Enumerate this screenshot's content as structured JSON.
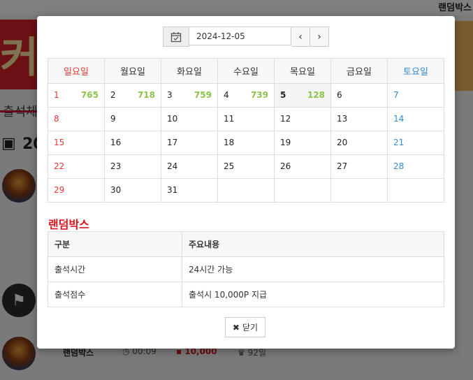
{
  "background": {
    "top_right_text": "랜덤박스",
    "section_label": "출석체",
    "year_partial": "20",
    "row": {
      "name": "랜덤박스",
      "time": "00:09",
      "points": "10,000",
      "days": "92일"
    }
  },
  "modal": {
    "date_value": "2024-12-05",
    "prev_label": "‹",
    "next_label": "›",
    "weekdays": [
      "일요일",
      "월요일",
      "화요일",
      "수요일",
      "목요일",
      "금요일",
      "토요일"
    ],
    "weeks": [
      [
        {
          "day": "1",
          "score": "765"
        },
        {
          "day": "2",
          "score": "718"
        },
        {
          "day": "3",
          "score": "759"
        },
        {
          "day": "4",
          "score": "739"
        },
        {
          "day": "5",
          "score": "128"
        },
        {
          "day": "6",
          "score": ""
        },
        {
          "day": "7",
          "score": ""
        }
      ],
      [
        {
          "day": "8",
          "score": ""
        },
        {
          "day": "9",
          "score": ""
        },
        {
          "day": "10",
          "score": ""
        },
        {
          "day": "11",
          "score": ""
        },
        {
          "day": "12",
          "score": ""
        },
        {
          "day": "13",
          "score": ""
        },
        {
          "day": "14",
          "score": ""
        }
      ],
      [
        {
          "day": "15",
          "score": ""
        },
        {
          "day": "16",
          "score": ""
        },
        {
          "day": "17",
          "score": ""
        },
        {
          "day": "18",
          "score": ""
        },
        {
          "day": "19",
          "score": ""
        },
        {
          "day": "20",
          "score": ""
        },
        {
          "day": "21",
          "score": ""
        }
      ],
      [
        {
          "day": "22",
          "score": ""
        },
        {
          "day": "23",
          "score": ""
        },
        {
          "day": "24",
          "score": ""
        },
        {
          "day": "25",
          "score": ""
        },
        {
          "day": "26",
          "score": ""
        },
        {
          "day": "27",
          "score": ""
        },
        {
          "day": "28",
          "score": ""
        }
      ],
      [
        {
          "day": "29",
          "score": ""
        },
        {
          "day": "30",
          "score": ""
        },
        {
          "day": "31",
          "score": ""
        },
        {
          "day": "",
          "score": ""
        },
        {
          "day": "",
          "score": ""
        },
        {
          "day": "",
          "score": ""
        },
        {
          "day": "",
          "score": ""
        }
      ]
    ],
    "info_title": "랜덤박스",
    "info_headers": [
      "구분",
      "주요내용"
    ],
    "info_rows": [
      [
        "출석시간",
        "24시간 가능"
      ],
      [
        "출석점수",
        "출석시 10,000P 지급"
      ]
    ],
    "close_label": "닫기"
  },
  "colors": {
    "sunday": "#e53935",
    "saturday": "#2e8bd6",
    "score": "#8bc34a",
    "info_title": "#e0141c"
  }
}
